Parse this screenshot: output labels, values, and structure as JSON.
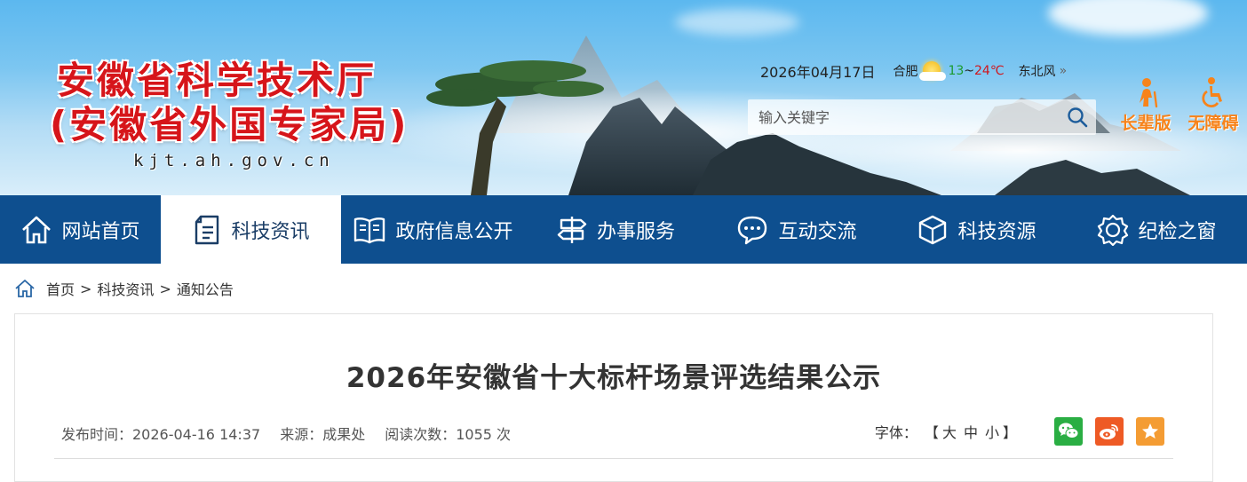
{
  "header": {
    "title_line1": "安徽省科学技术厅",
    "title_line2": "(安徽省外国专家局)",
    "domain": "kjt.ah.gov.cn",
    "date": "2026年04月17日",
    "city": "合肥",
    "weather_icon": "sun-cloud-icon",
    "temp_low": "13",
    "temp_sep": "~",
    "temp_high": "24℃",
    "wind": "东北风",
    "more": "»",
    "search_placeholder": "输入关键字",
    "elder_label": "长辈版",
    "accessible_label": "无障碍"
  },
  "nav": {
    "items": [
      {
        "label": "网站首页",
        "icon": "home-icon"
      },
      {
        "label": "科技资讯",
        "icon": "document-icon",
        "active": true
      },
      {
        "label": "政府信息公开",
        "icon": "book-icon"
      },
      {
        "label": "办事服务",
        "icon": "signpost-icon"
      },
      {
        "label": "互动交流",
        "icon": "chat-icon"
      },
      {
        "label": "科技资源",
        "icon": "cube-icon"
      },
      {
        "label": "纪检之窗",
        "icon": "gear-badge-icon"
      }
    ]
  },
  "breadcrumb": {
    "home": "首页",
    "sep": ">",
    "level1": "科技资讯",
    "level2": "通知公告"
  },
  "article": {
    "title": "2026年安徽省十大标杆场景评选结果公示",
    "publish_time": "发布时间：2026-04-16 14:37",
    "source": "来源：成果处",
    "reads": "阅读次数：1055 次",
    "font_label": "字体：",
    "bracket_open": "【",
    "font_large": "大",
    "font_medium": "中",
    "font_small": "小",
    "bracket_close": "】"
  },
  "colors": {
    "nav_bg": "#0e4f8f",
    "title_red": "#d6151a",
    "assist_orange": "#f7831a",
    "wechat_green": "#2aae43",
    "weibo_orange": "#ee5a25",
    "favorite_orange": "#f49c33"
  }
}
